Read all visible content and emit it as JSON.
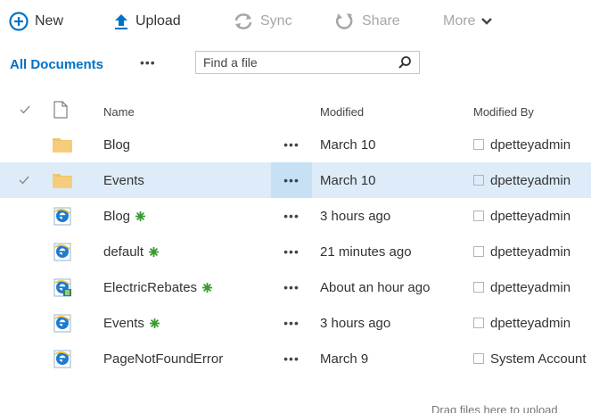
{
  "command_bar": {
    "new_label": "New",
    "upload_label": "Upload",
    "sync_label": "Sync",
    "share_label": "Share",
    "more_label": "More"
  },
  "view_bar": {
    "view_label": "All Documents",
    "ellipsis": "•••",
    "search_placeholder": "Find a file"
  },
  "table": {
    "headers": {
      "name": "Name",
      "modified": "Modified",
      "modified_by": "Modified By"
    },
    "rows": [
      {
        "type": "folder-icon",
        "name": "Blog",
        "new": false,
        "modified": "March 10",
        "modified_by": "dpetteyadmin",
        "selected": false
      },
      {
        "type": "folder-icon",
        "name": "Events",
        "new": false,
        "modified": "March 10",
        "modified_by": "dpetteyadmin",
        "selected": true
      },
      {
        "type": "ie-page-icon",
        "name": "Blog",
        "new": true,
        "modified": "3 hours ago",
        "modified_by": "dpetteyadmin",
        "selected": false
      },
      {
        "type": "ie-page-icon",
        "name": "default",
        "new": true,
        "modified": "21 minutes ago",
        "modified_by": "dpetteyadmin",
        "selected": false
      },
      {
        "type": "ie-page-icon",
        "name": "ElectricRebates",
        "new": true,
        "modified": "About an hour ago",
        "modified_by": "dpetteyadmin",
        "selected": false
      },
      {
        "type": "ie-page-icon",
        "name": "Events",
        "new": true,
        "modified": "3 hours ago",
        "modified_by": "dpetteyadmin",
        "selected": false
      },
      {
        "type": "ie-page-icon",
        "name": "PageNotFoundError",
        "new": false,
        "modified": "March 9",
        "modified_by": "System Account",
        "selected": false
      }
    ],
    "row_ellipsis": "•••"
  },
  "footer": {
    "drag_hint": "Drag files here to upload"
  },
  "colors": {
    "accent": "#0072c6",
    "selected_row": "#deecf9",
    "folder": "#f2c46b",
    "new_badge": "#3a9a2f"
  }
}
